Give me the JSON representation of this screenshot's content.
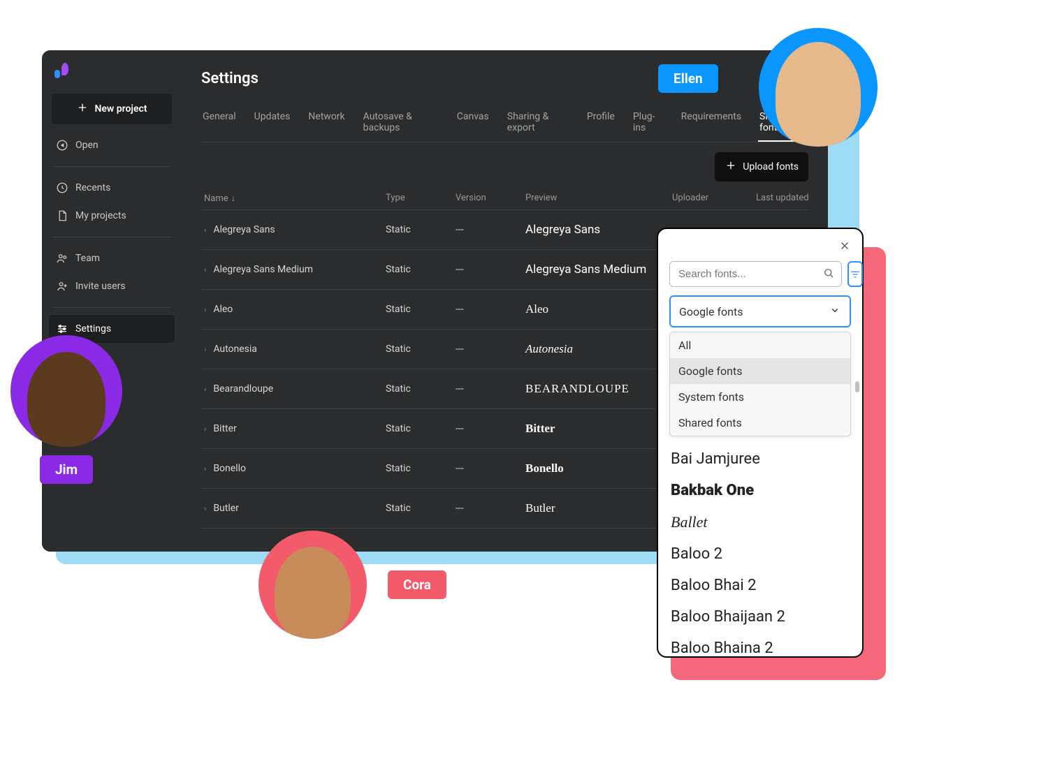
{
  "sidebar": {
    "new_project": "New project",
    "open": "Open",
    "recents": "Recents",
    "my_projects": "My projects",
    "team": "Team",
    "invite_users": "Invite users",
    "settings": "Settings"
  },
  "page": {
    "title": "Settings"
  },
  "tabs": [
    "General",
    "Updates",
    "Network",
    "Autosave & backups",
    "Canvas",
    "Sharing & export",
    "Profile",
    "Plug-ins",
    "Requirements",
    "Shared fonts"
  ],
  "active_tab": "Shared fonts",
  "upload_button": "Upload fonts",
  "table": {
    "columns": [
      "Name",
      "Type",
      "Version",
      "Preview",
      "Uploader",
      "Last updated"
    ],
    "sort_column": "Name",
    "rows": [
      {
        "name": "Alegreya Sans",
        "type": "Static",
        "version": "---",
        "preview": "Alegreya Sans",
        "preview_class": ""
      },
      {
        "name": "Alegreya Sans Medium",
        "type": "Static",
        "version": "---",
        "preview": "Alegreya Sans Medium",
        "preview_class": ""
      },
      {
        "name": "Aleo",
        "type": "Static",
        "version": "---",
        "preview": "Aleo",
        "preview_class": "preview-aleo"
      },
      {
        "name": "Autonesia",
        "type": "Static",
        "version": "---",
        "preview": "Autonesia",
        "preview_class": "preview-autonesia"
      },
      {
        "name": "Bearandloupe",
        "type": "Static",
        "version": "---",
        "preview": "BEARANDLOUPE",
        "preview_class": "preview-bearandloupe"
      },
      {
        "name": "Bitter",
        "type": "Static",
        "version": "---",
        "preview": "Bitter",
        "preview_class": "preview-bitter"
      },
      {
        "name": "Bonello",
        "type": "Static",
        "version": "---",
        "preview": "Bonello",
        "preview_class": "preview-bonello"
      },
      {
        "name": "Butler",
        "type": "Static",
        "version": "---",
        "preview": "Butler",
        "preview_class": "preview-butler"
      }
    ]
  },
  "font_panel": {
    "search_placeholder": "Search fonts...",
    "dropdown_value": "Google fonts",
    "dropdown_options": [
      "All",
      "Google fonts",
      "System fonts",
      "Shared fonts"
    ],
    "selected_option": "Google fonts",
    "font_list": [
      "Bai Jamjuree",
      "Bakbak One",
      "Ballet",
      "Baloo 2",
      "Baloo Bhai 2",
      "Baloo Bhaijaan 2",
      "Baloo Bhaina 2"
    ]
  },
  "people": {
    "jim": "Jim",
    "ellen": "Ellen",
    "cora": "Cora"
  },
  "colors": {
    "purple": "#8a2ae6",
    "blue": "#0a95ff",
    "pink": "#f45b6a"
  }
}
